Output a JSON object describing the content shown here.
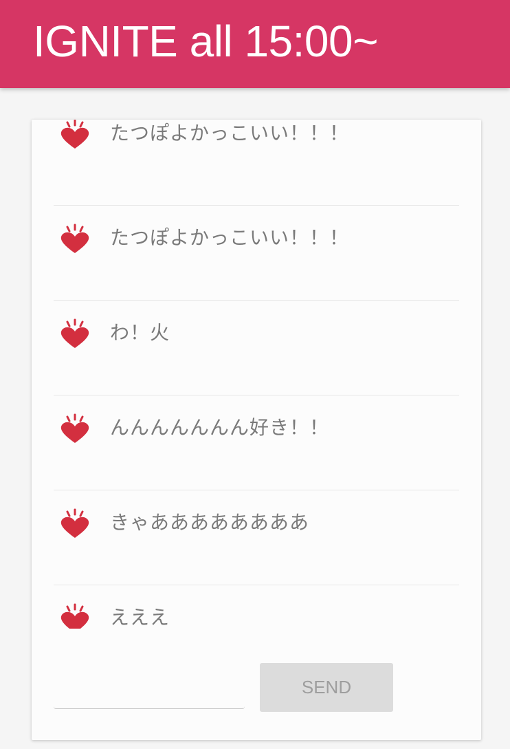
{
  "header": {
    "title": "IGNITE all 15:00~",
    "color": "#d63664"
  },
  "messages": [
    {
      "text": "たつぽよかっこいい！！！",
      "icon": "heart-icon"
    },
    {
      "text": "たつぽよかっこいい！！！",
      "icon": "heart-icon"
    },
    {
      "text": "わ！火",
      "icon": "heart-icon"
    },
    {
      "text": "んんんんんんん好き！！",
      "icon": "heart-icon"
    },
    {
      "text": "きゃああああああああ",
      "icon": "heart-icon"
    },
    {
      "text": "えええ",
      "icon": "heart-icon"
    }
  ],
  "composer": {
    "input_value": "",
    "send_label": "SEND"
  },
  "colors": {
    "heart": "#d32f3f",
    "text": "#7a7a7a",
    "button_bg": "#dcdcdc"
  }
}
